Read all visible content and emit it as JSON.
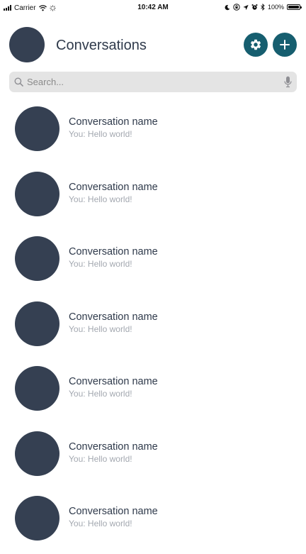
{
  "status_bar": {
    "carrier": "Carrier",
    "time": "10:42 AM",
    "battery": "100%",
    "battery_level": 1.0,
    "icons": [
      "signal-icon",
      "wifi-icon",
      "loading-icon",
      "moon-icon",
      "lock-rotation-icon",
      "location-icon",
      "alarm-icon",
      "bluetooth-icon",
      "battery-icon"
    ]
  },
  "header": {
    "title": "Conversations",
    "settings_icon": "gear-icon",
    "add_icon": "plus-icon"
  },
  "search": {
    "placeholder": "Search...",
    "value": "",
    "search_icon": "search-icon",
    "mic_icon": "microphone-icon"
  },
  "conversations": [
    {
      "name": "Conversation name",
      "preview": "You: Hello world!"
    },
    {
      "name": "Conversation name",
      "preview": "You: Hello world!"
    },
    {
      "name": "Conversation name",
      "preview": "You: Hello world!"
    },
    {
      "name": "Conversation name",
      "preview": "You: Hello world!"
    },
    {
      "name": "Conversation name",
      "preview": "You: Hello world!"
    },
    {
      "name": "Conversation name",
      "preview": "You: Hello world!"
    },
    {
      "name": "Conversation name",
      "preview": "You: Hello world!"
    }
  ],
  "colors": {
    "accent": "#165e6f",
    "avatar": "#354052",
    "title_text": "#2f3a4b",
    "preview_text": "#a3a8b0",
    "search_background": "#e4e4e4"
  }
}
